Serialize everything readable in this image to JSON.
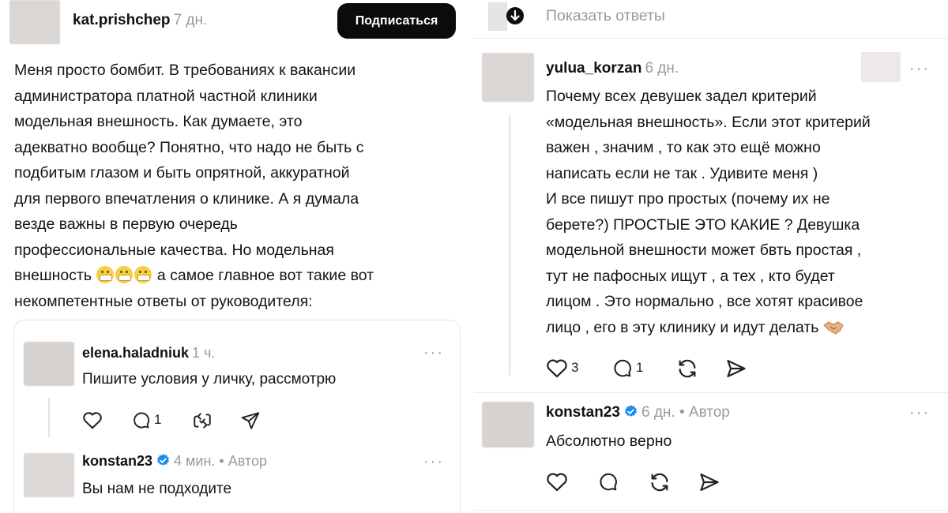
{
  "post": {
    "username": "kat.prishchep",
    "time": "7 дн.",
    "follow_label": "Подписаться",
    "text_lines": [
      "Меня просто бомбит. В требованиях к вакансии",
      "администратора платной частной клиники",
      "модельная внешность. Как думаете, это",
      "адекватно вообще? Понятно, что надо не быть с",
      "подбитым глазом и быть опрятной, аккуратной",
      "для первого впечатления о клинике. А я думала",
      "везде важны в первую очередь",
      "профессиональные качества. Но модельная"
    ],
    "line9_start": "внешность",
    "line9_end": "а самое главное вот такие вот",
    "line10": "некомпетентные ответы от руководителя:"
  },
  "quote": {
    "comment1": {
      "username": "elena.haladniuk",
      "time": "1 ч.",
      "text": "Пишите условия у личку, рассмотрю",
      "reply_count": "1"
    },
    "comment2": {
      "username": "konstan23",
      "time": "4 мин. • Автор",
      "text": "Вы нам не подходите"
    }
  },
  "right": {
    "show_replies": "Показать ответы",
    "comment1": {
      "username": "yulua_korzan",
      "time": "6 дн.",
      "text_lines": [
        "Почему всех девушек задел критерий",
        "«модельная внешность». Если этот критерий",
        "важен , значим , то как это ещё можно",
        "написать если не так . Удивите меня )",
        "И все пишут про простых (почему их не",
        "берете?) ПРОСТЫЕ ЭТО КАКИЕ ? Девушка",
        "модельной внешности может бвть простая ,",
        "тут не  пафосных ищут , а тех , кто будет",
        "лицом . Это нормально , все хотят красивое"
      ],
      "last_line": "лицо , его в эту клинику и идут делать",
      "like_count": "3",
      "reply_count": "1"
    },
    "comment2": {
      "username": "konstan23",
      "time": "6 дн. • Автор",
      "text": "Абсолютно верно"
    }
  },
  "icons": {
    "more": "more-dots-icon",
    "like": "heart-icon",
    "reply": "comment-bubble-icon",
    "repost": "repost-icon",
    "share": "send-icon",
    "verified": "verified-badge-icon",
    "down": "arrow-down-circle-icon"
  },
  "colors": {
    "verified": "#1a8cf0",
    "button_bg": "#0b0b0b",
    "meta_gray": "#9a9a9a"
  }
}
